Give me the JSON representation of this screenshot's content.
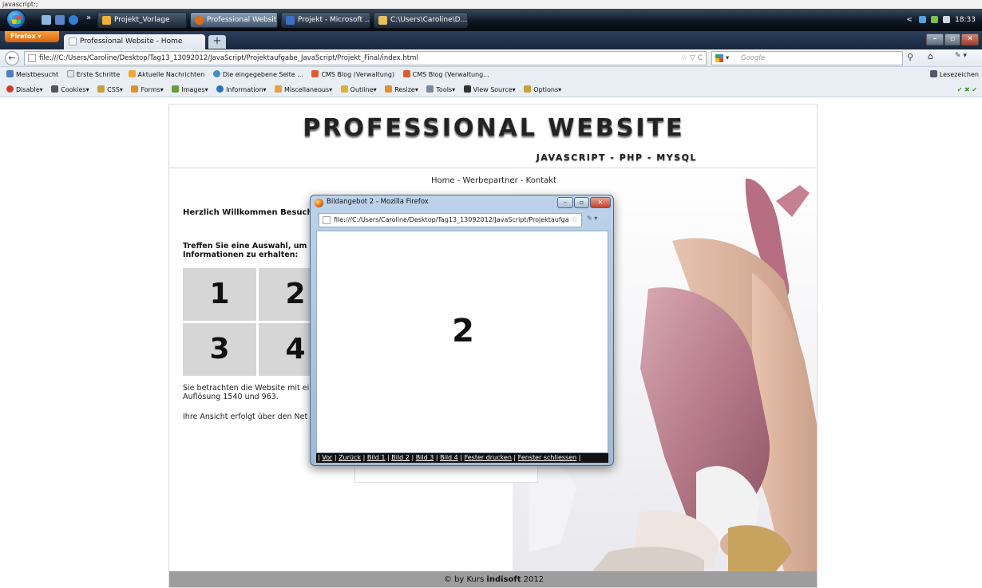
{
  "status_line": "javascript:;",
  "taskbar": {
    "buttons": [
      {
        "label": "Projekt_Vorlage"
      },
      {
        "label": "Professional Websit..."
      },
      {
        "label": "Projekt - Microsoft ..."
      },
      {
        "label": "C:\\Users\\Caroline\\D..."
      }
    ],
    "overflow": "»",
    "clock": "18:33",
    "tray_arrow": "<"
  },
  "browser": {
    "menu_button": "Firefox",
    "tab_title": "Professional Website - Home",
    "tab_close": "×",
    "new_tab": "+",
    "window_controls": {
      "minimize": "–",
      "maximize": "▫",
      "close": "✕"
    },
    "back": "←",
    "url": "file:///C:/Users/Caroline/Desktop/Tag13_13092012/JavaScript/Projektaufgabe_JavaScript/Projekt_Final/index.html",
    "url_right": "☆ ▽ C",
    "search_placeholder": "Google",
    "search_go": "⚲",
    "home": "⌂",
    "nav_tools": "✎ ▾"
  },
  "bookmarks": {
    "items": [
      {
        "label": "Meistbesucht",
        "color": "#4a7fc1"
      },
      {
        "label": "Erste Schritte",
        "color": "#dfe6ee"
      },
      {
        "label": "Aktuelle Nachrichten",
        "color": "#f0a830"
      },
      {
        "label": "Die eingegebene Seite ...",
        "color": "#3d8ec9"
      },
      {
        "label": "CMS Blog (Verwaltung)",
        "color": "#e25a2a"
      },
      {
        "label": "CMS Blog (Verwaltung...",
        "color": "#e25a2a"
      }
    ],
    "right_label": "Lesezeichen"
  },
  "devbar": {
    "items": [
      {
        "label": "Disable▾",
        "color": "#d23b2c"
      },
      {
        "label": "Cookies▾",
        "color": "#555555"
      },
      {
        "label": "CSS▾",
        "color": "#c8a13a"
      },
      {
        "label": "Forms▾",
        "color": "#e0902c"
      },
      {
        "label": "Images▾",
        "color": "#6a9a3c"
      },
      {
        "label": "Information▾",
        "color": "#2f6fc6"
      },
      {
        "label": "Miscellaneous▾",
        "color": "#e3a33a"
      },
      {
        "label": "Outline▾",
        "color": "#e0b030"
      },
      {
        "label": "Resize▾",
        "color": "#e0902c"
      },
      {
        "label": "Tools▾",
        "color": "#7a8a9a"
      },
      {
        "label": "View Source▾",
        "color": "#333333"
      },
      {
        "label": "Options▾",
        "color": "#c8a13a"
      }
    ],
    "status": "✔ ✖ ✔"
  },
  "site": {
    "title": "PROFESSIONAL WEBSITE",
    "subtitle": "JAVASCRIPT - PHP - MYSQL",
    "nav": "Home - Werbepartner - Kontakt",
    "welcome": "Herzlich Willkommen Besucher",
    "prompt": "Treffen Sie eine Auswahl, um w Informationen zu erhalten:",
    "tiles": [
      "1",
      "2",
      "3",
      "4"
    ],
    "info": "Sie betrachten die Website mit ei Auflösung 1540 und 963.",
    "view": "Ihre Ansicht erfolgt über den Net",
    "footer_prefix": "© by Kurs ",
    "footer_brand": "indisoft",
    "footer_year": " 2012"
  },
  "popup": {
    "title": "Bildangebot 2 - Mozilla Firefox",
    "controls": {
      "minimize": "–",
      "maximize": "▫",
      "close": "✕"
    },
    "url": "file:///C:/Users/Caroline/Desktop/Tag13_13092012/JavaScript/Projektaufga",
    "url_star": "☆",
    "tools": "✎ ▾",
    "digit": "2",
    "menu": [
      "Vor",
      "Zurück",
      "Bild 1",
      "Bild 2",
      "Bild 3",
      "Bild 4",
      "Fester drucken",
      "Fenster schliessen"
    ]
  }
}
